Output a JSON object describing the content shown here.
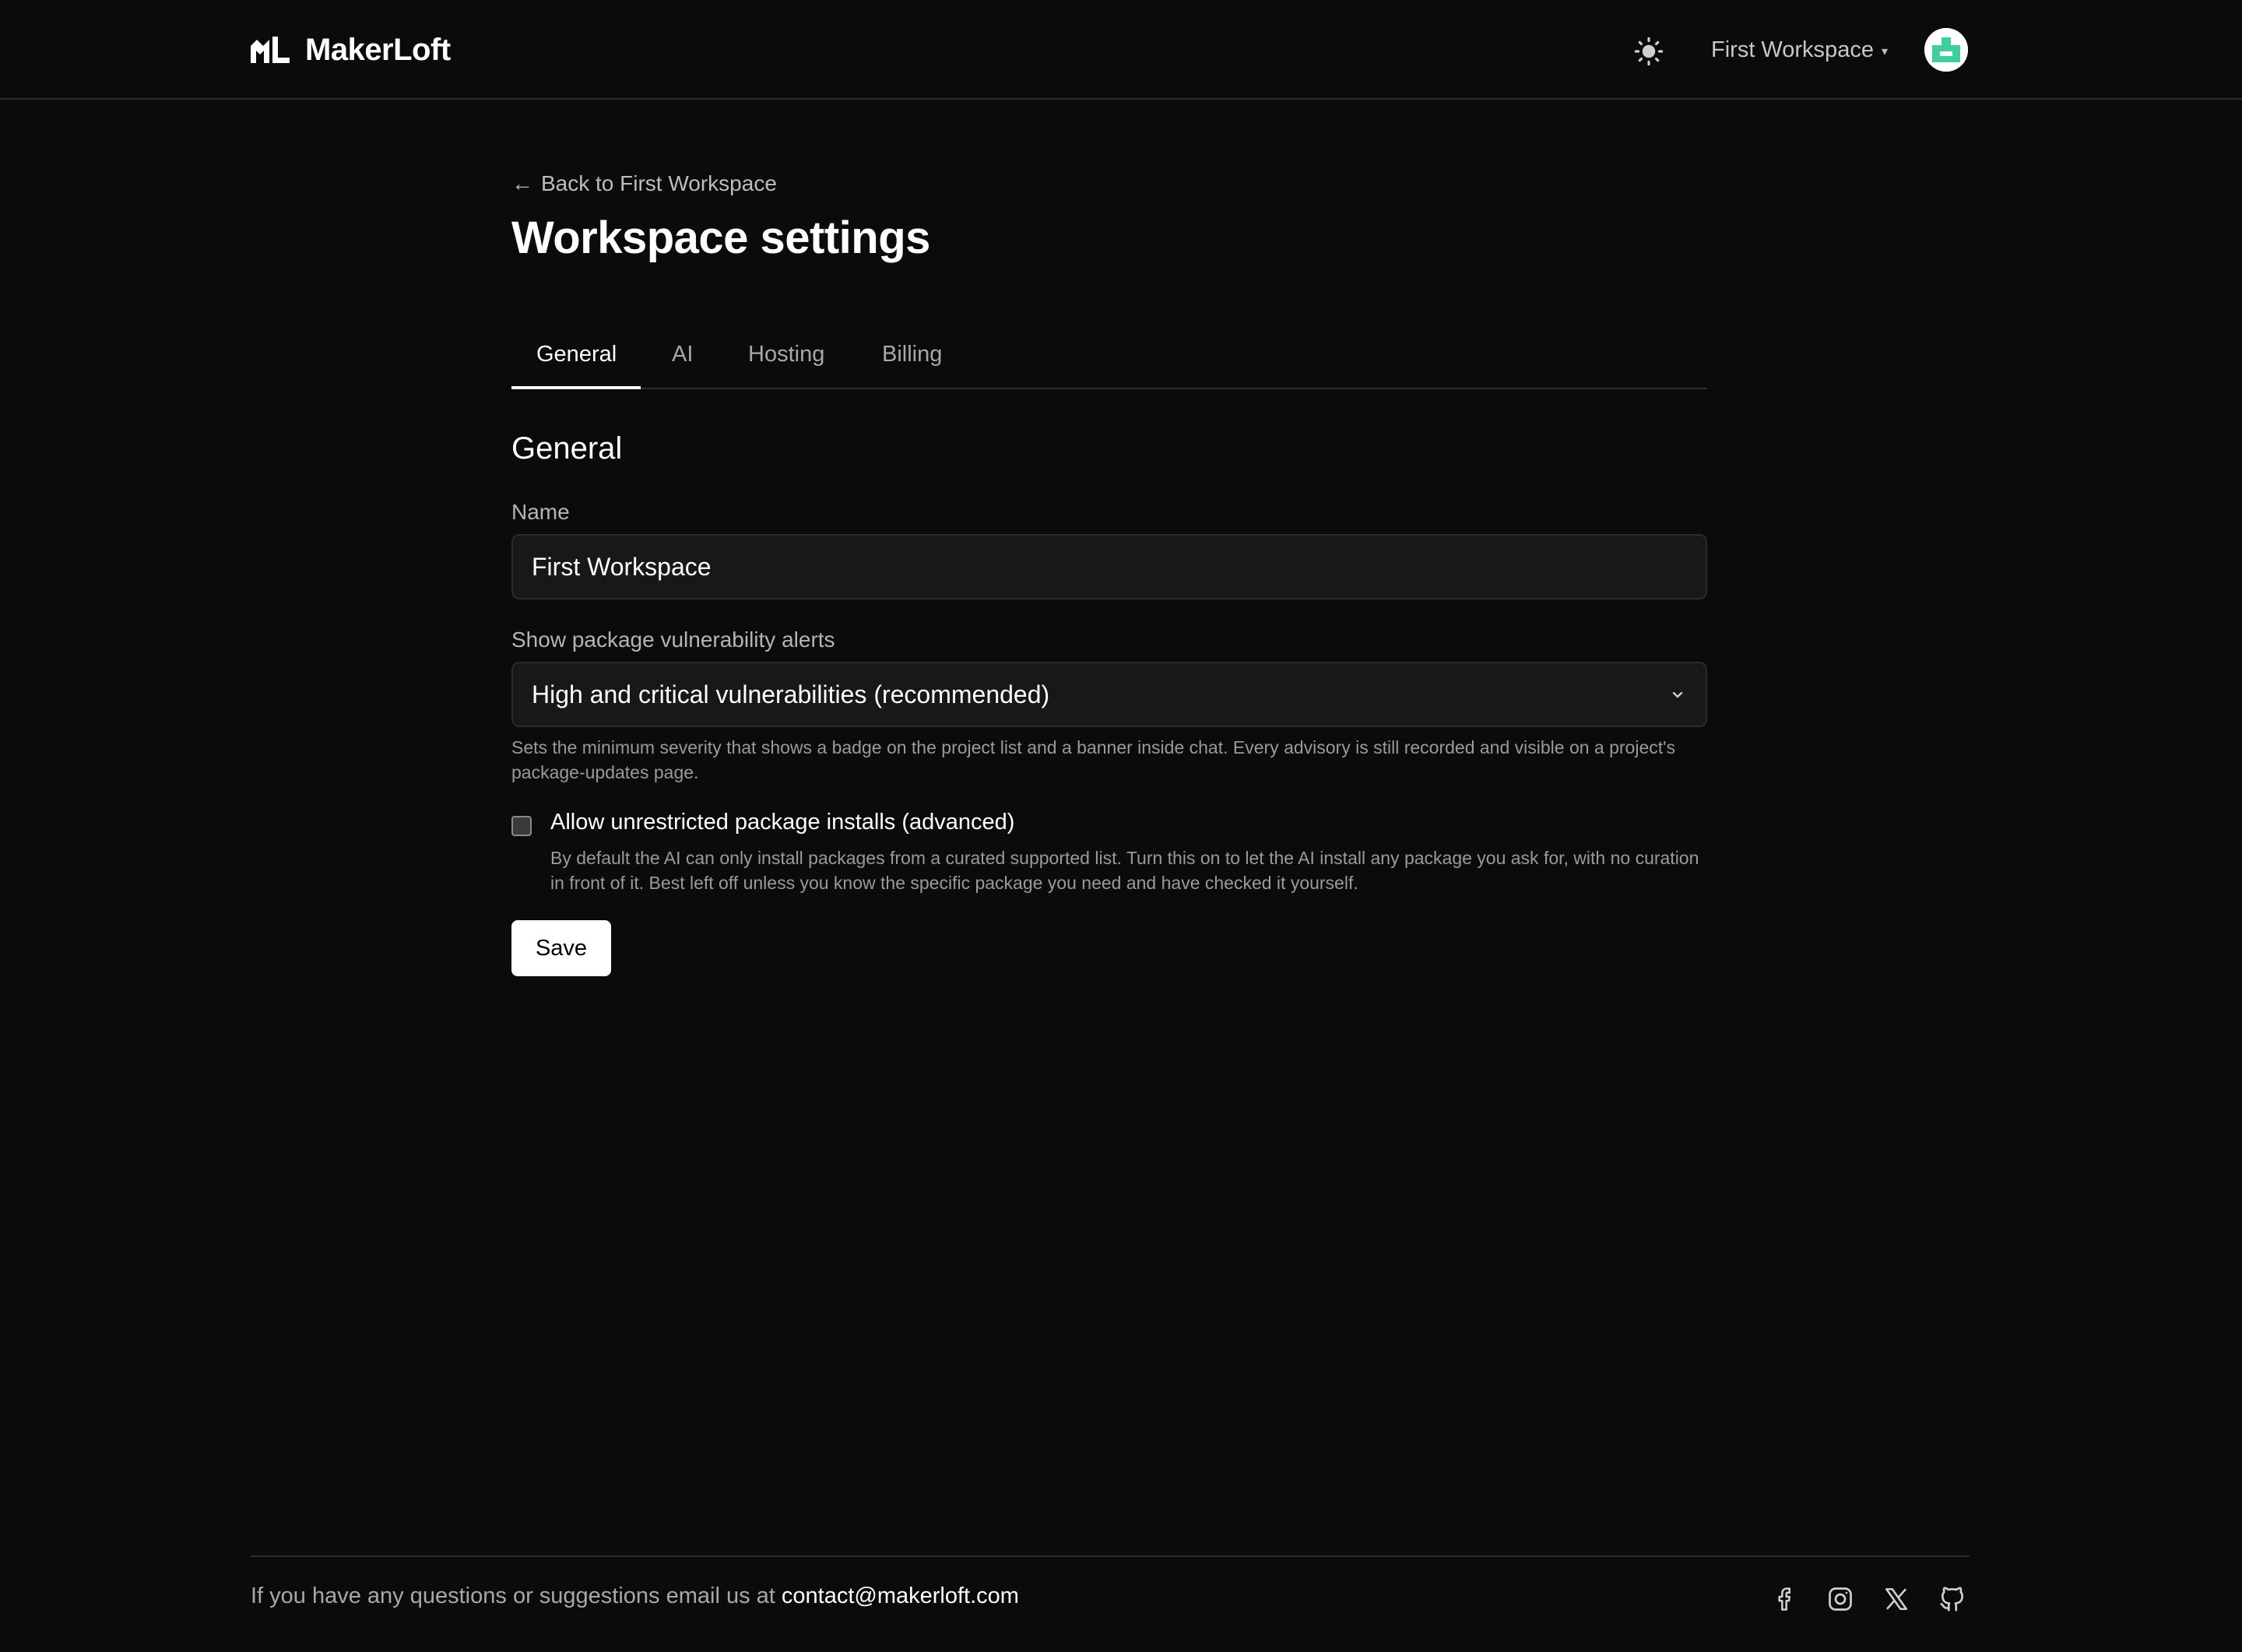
{
  "header": {
    "brand_name": "MakerLoft",
    "workspace_name": "First Workspace",
    "workspace_caret": "▾",
    "icons": [
      "makerloft-logo-icon",
      "sun-icon",
      "chevron-down-icon",
      "avatar"
    ]
  },
  "page": {
    "back_link_arrow": "←",
    "back_link_label": "Back to First Workspace",
    "title": "Workspace settings"
  },
  "tabs": [
    {
      "label": "General",
      "active": true
    },
    {
      "label": "AI",
      "active": false
    },
    {
      "label": "Hosting",
      "active": false
    },
    {
      "label": "Billing",
      "active": false
    }
  ],
  "general": {
    "section_title": "General",
    "name_label": "Name",
    "name_value": "First Workspace",
    "vuln_label": "Show package vulnerability alerts",
    "vuln_value": "High and critical vulnerabilities (recommended)",
    "vuln_help": "Sets the minimum severity that shows a badge on the project list and a banner inside chat. Every advisory is still recorded and visible on a project's package-updates page.",
    "unrestricted_label": "Allow unrestricted package installs (advanced)",
    "unrestricted_checked": false,
    "unrestricted_help": "By default the AI can only install packages from a curated supported list. Turn this on to let the AI install any package you ask for, with no curation in front of it. Best left off unless you know the specific package you need and have checked it yourself.",
    "save_label": "Save"
  },
  "footer": {
    "text": "If you have any questions or suggestions email us at ",
    "email": "contact@makerloft.com",
    "social_icons": [
      "facebook-icon",
      "instagram-icon",
      "x-icon",
      "github-icon"
    ]
  },
  "colors": {
    "background": "#0b0b0b",
    "surface": "#181818",
    "border": "#2b2b2b",
    "text": "#ffffff",
    "muted_text": "#9a9a9a",
    "avatar_accent": "#3ecf9b"
  }
}
